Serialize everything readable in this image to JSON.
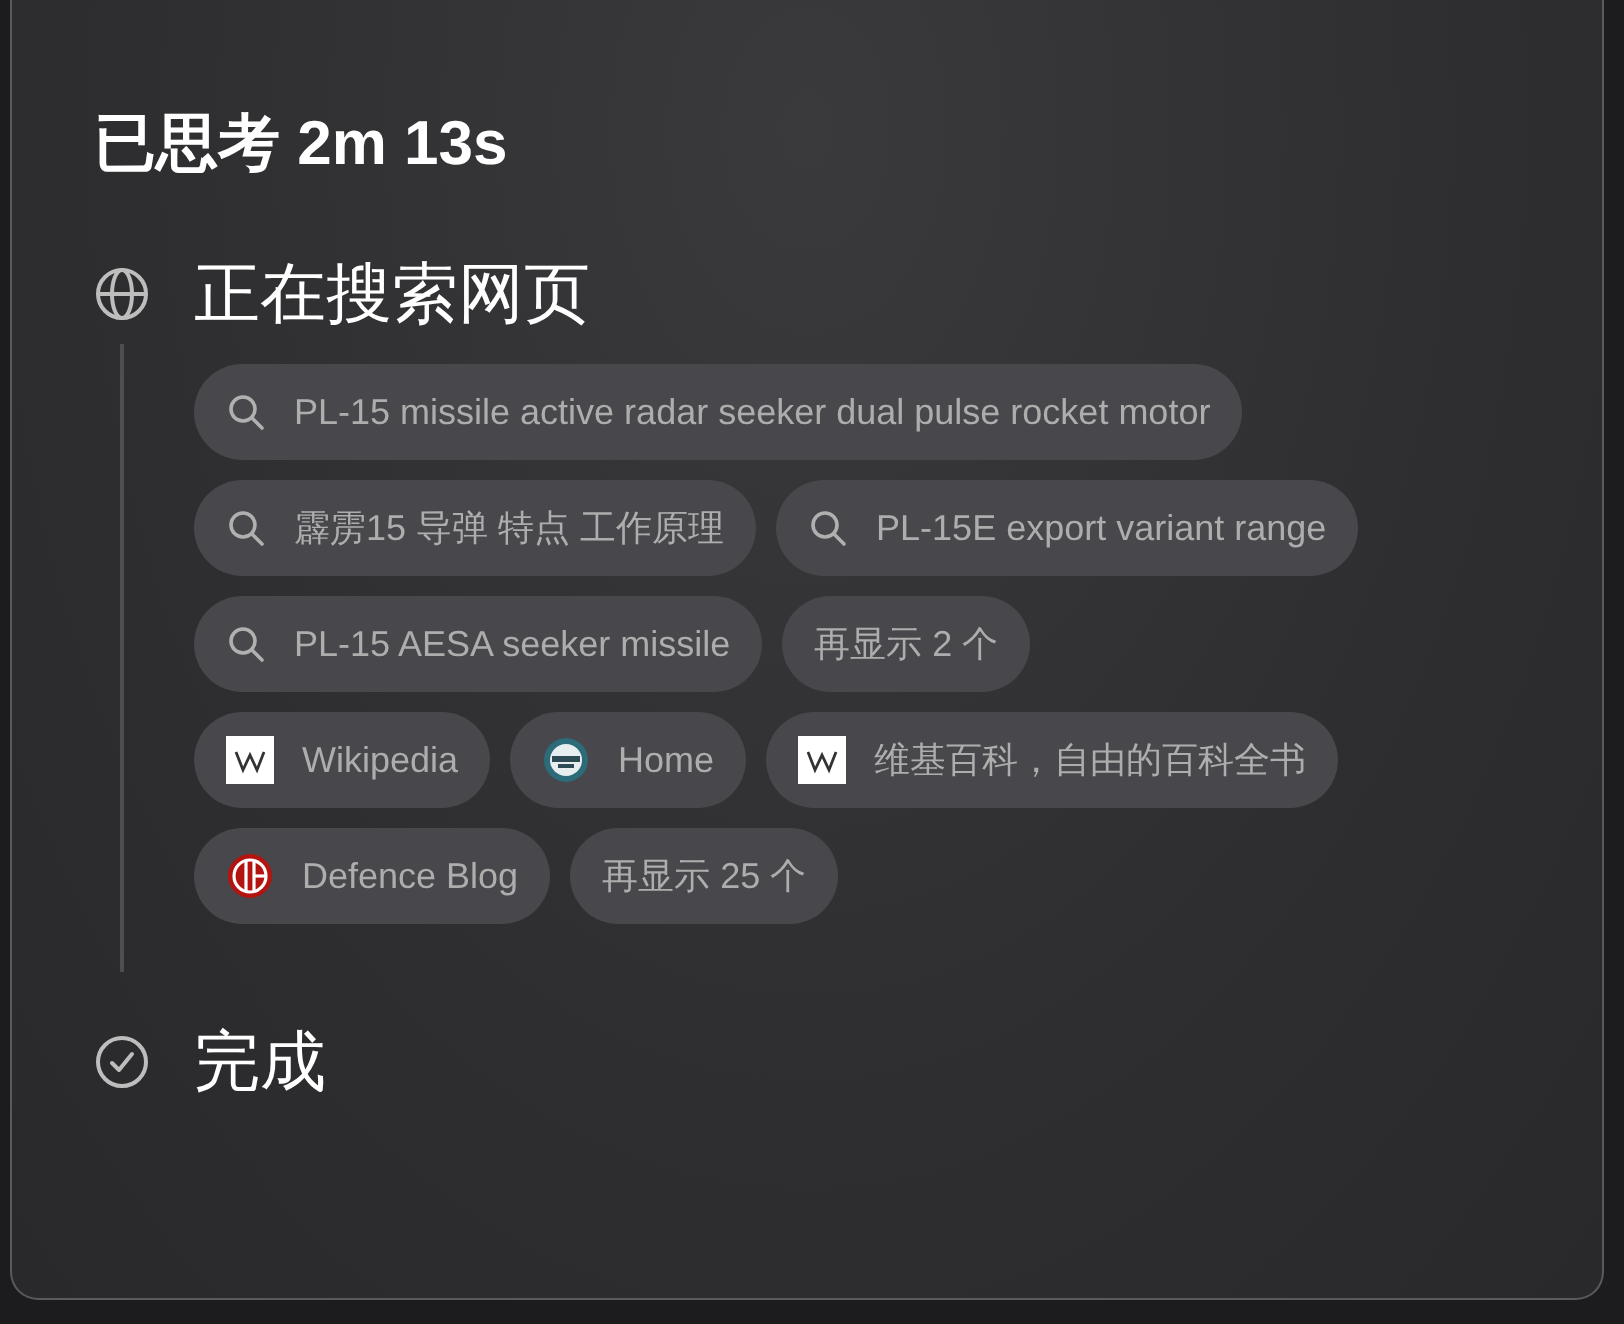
{
  "title": "已思考 2m 13s",
  "steps": [
    {
      "kind": "search",
      "label": "正在搜索网页",
      "rows": [
        {
          "chips": [
            {
              "kind": "query",
              "text": "PL-15 missile active radar seeker dual pulse rocket motor"
            }
          ]
        },
        {
          "chips": [
            {
              "kind": "query",
              "text": "霹雳15 导弹 特点 工作原理"
            },
            {
              "kind": "query",
              "text": "PL-15E export variant range"
            }
          ]
        },
        {
          "chips": [
            {
              "kind": "query",
              "text": "PL-15 AESA seeker missile"
            },
            {
              "kind": "more",
              "text": "再显示 2 个"
            }
          ]
        },
        {
          "chips": [
            {
              "kind": "wiki",
              "text": "Wikipedia"
            },
            {
              "kind": "emblem",
              "text": "Home"
            },
            {
              "kind": "wiki",
              "text": "维基百科，自由的百科全书"
            }
          ]
        },
        {
          "chips": [
            {
              "kind": "blog",
              "text": "Defence Blog"
            },
            {
              "kind": "more",
              "text": "再显示 25 个"
            }
          ]
        }
      ]
    },
    {
      "kind": "done",
      "label": "完成"
    }
  ]
}
